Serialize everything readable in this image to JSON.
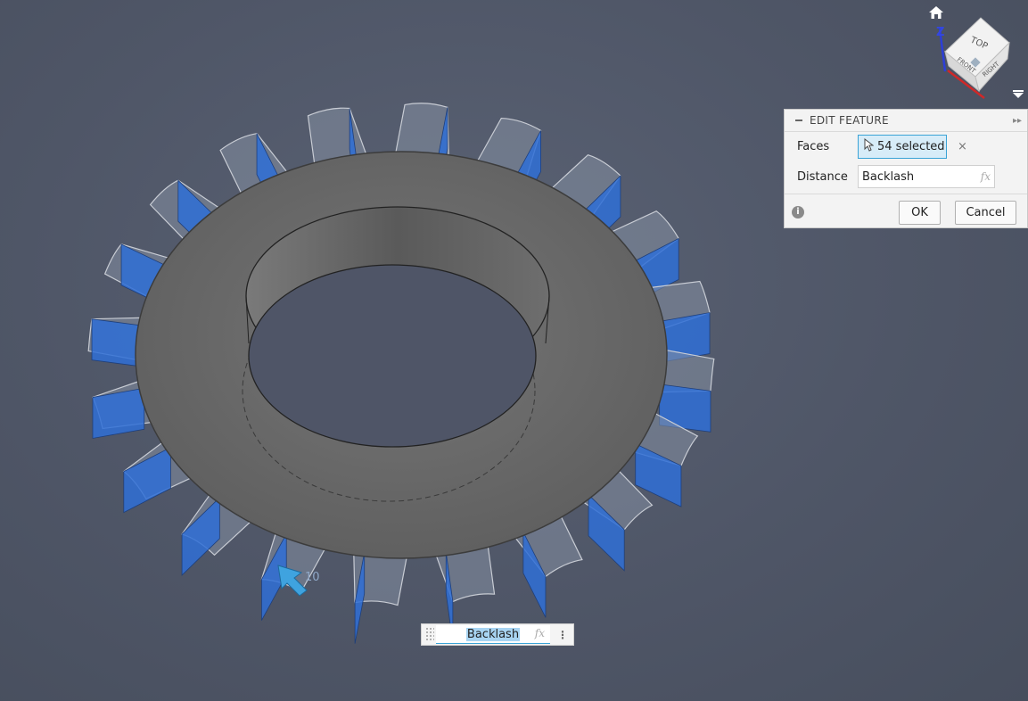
{
  "panel": {
    "title": "EDIT FEATURE",
    "faces_label": "Faces",
    "faces_value": "54 selected",
    "faces_clear": "×",
    "distance_label": "Distance",
    "distance_value": "Backlash",
    "fx": "fx",
    "ok": "OK",
    "cancel": "Cancel",
    "info": "i"
  },
  "floating_input": {
    "value": "Backlash",
    "fx": "fx",
    "menu": "⋮"
  },
  "viewcube": {
    "top": "TOP",
    "front": "FRONT",
    "right": "RIGHT",
    "axis_z": "Z"
  },
  "manipulator_label": "10",
  "icons": {
    "home": "home-icon",
    "cursor": "pointer-cursor-icon",
    "info": "info-icon",
    "expand": "double-chevron-right-icon"
  },
  "colors": {
    "selection_blue": "#2f6fd6",
    "viewport_bg": "#50576a",
    "gear_gray": "#6a6a6a",
    "accent": "#3aa3d6"
  }
}
